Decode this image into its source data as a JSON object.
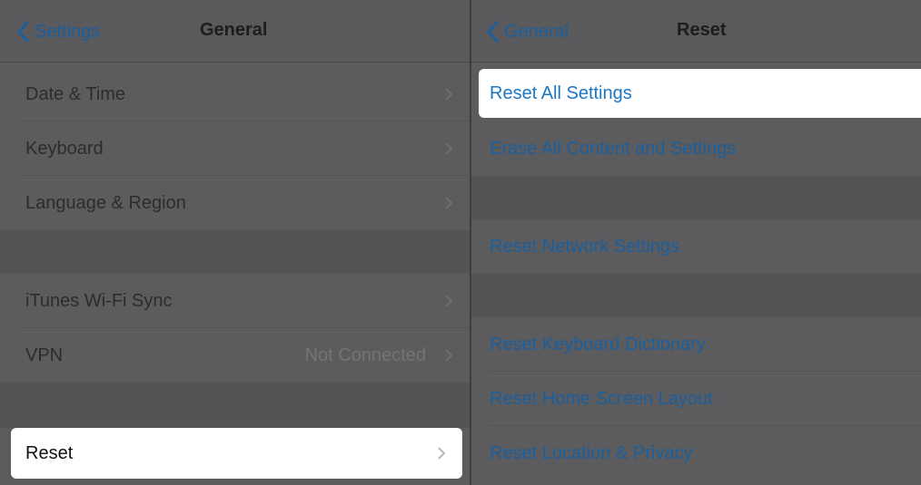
{
  "left": {
    "back_label": "Settings",
    "title": "General",
    "rows": [
      {
        "label": "Date & Time",
        "value": ""
      },
      {
        "label": "Keyboard",
        "value": ""
      },
      {
        "label": "Language & Region",
        "value": ""
      },
      {
        "label": "iTunes Wi-Fi Sync",
        "value": ""
      },
      {
        "label": "VPN",
        "value": "Not Connected"
      },
      {
        "label": "Reset",
        "value": ""
      }
    ]
  },
  "right": {
    "back_label": "General",
    "title": "Reset",
    "items": [
      {
        "label": "Reset All Settings"
      },
      {
        "label": "Erase All Content and Settings"
      },
      {
        "label": "Reset Network Settings"
      },
      {
        "label": "Reset Keyboard Dictionary"
      },
      {
        "label": "Reset Home Screen Layout"
      },
      {
        "label": "Reset Location & Privacy"
      }
    ]
  },
  "colors": {
    "accent": "#1a5f9e",
    "highlight_bg": "#ffffff",
    "dim_bg": "#5c5c5e"
  },
  "icons": {
    "back": "chevron-left-icon",
    "disclosure": "chevron-right-icon"
  }
}
